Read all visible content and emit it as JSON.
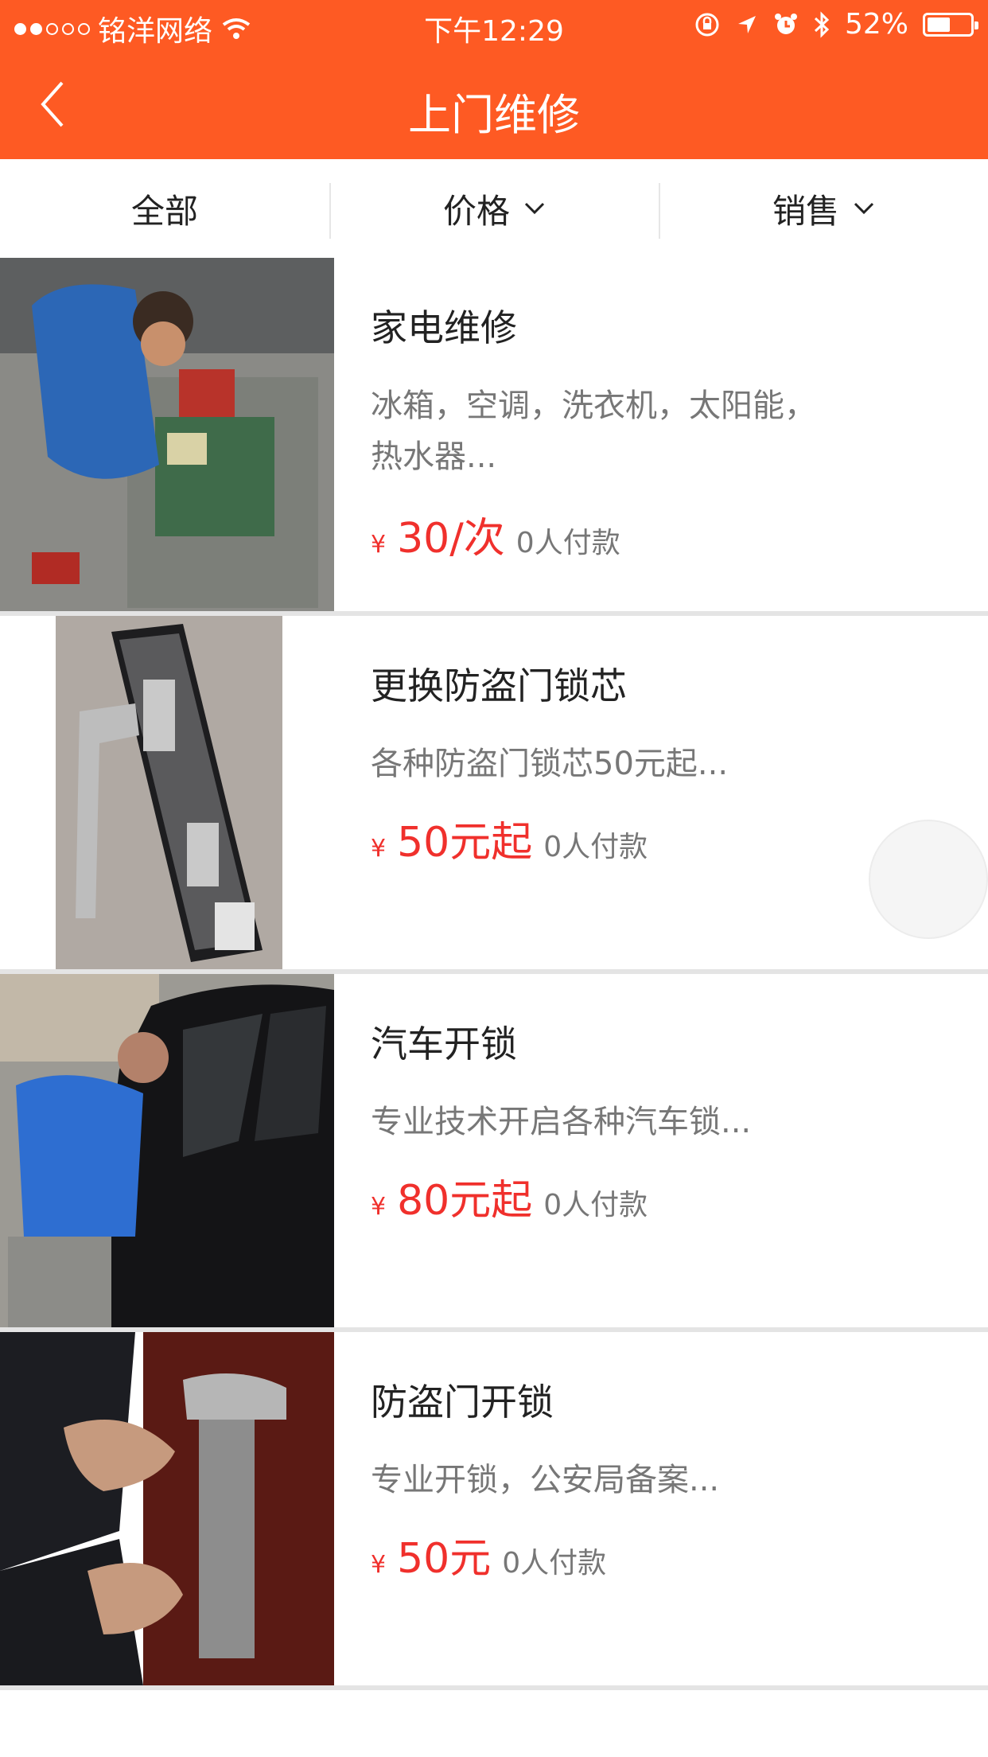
{
  "status_bar": {
    "carrier": "铭洋网络",
    "time": "下午12:29",
    "battery": "52%",
    "signal_bars_filled": 2,
    "signal_bars_total": 5,
    "battery_level": 0.52
  },
  "nav": {
    "title": "上门维修"
  },
  "filters": [
    {
      "label": "全部"
    },
    {
      "label": "价格"
    },
    {
      "label": "销售"
    }
  ],
  "items": [
    {
      "name": "家电维修",
      "desc": "冰箱，空调，洗衣机，太阳能，热水器...",
      "currency": "¥",
      "price": "30/次",
      "paid": "0人付款"
    },
    {
      "name": "更换防盗门锁芯",
      "desc": "各种防盗门锁芯50元起...",
      "currency": "¥",
      "price": "50元起",
      "paid": "0人付款"
    },
    {
      "name": "汽车开锁",
      "desc": "专业技术开启各种汽车锁...",
      "currency": "¥",
      "price": "80元起",
      "paid": "0人付款"
    },
    {
      "name": "防盗门开锁",
      "desc": "专业开锁，公安局备案...",
      "currency": "¥",
      "price": "50元",
      "paid": "0人付款"
    }
  ],
  "colors": {
    "header": "#fe5a23",
    "price": "#f0302c"
  }
}
